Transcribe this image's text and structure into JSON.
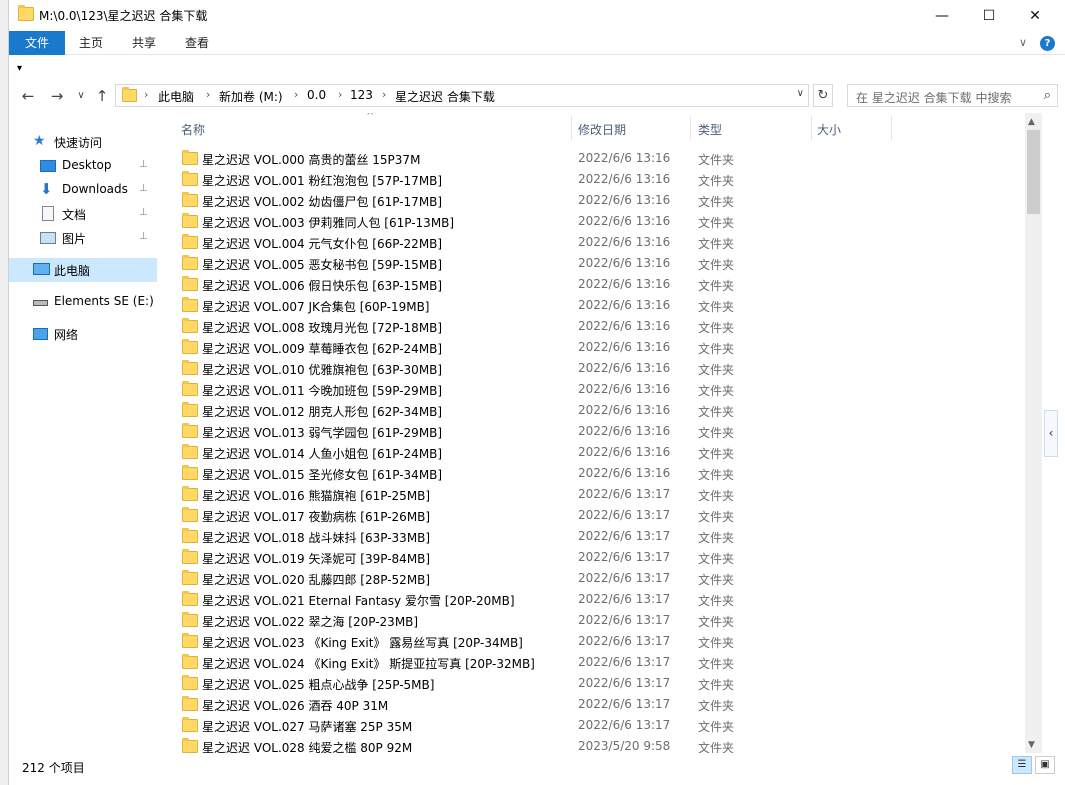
{
  "window": {
    "title": "M:\\0.0\\123\\星之迟迟 合集下载",
    "minimize_glyph": "—",
    "maximize_glyph": "☐",
    "close_glyph": "✕"
  },
  "ribbon": {
    "tabs": [
      "文件",
      "主页",
      "共享",
      "查看"
    ],
    "expand_glyph": "∨",
    "help_glyph": "?"
  },
  "qat": {
    "arrow": "▾"
  },
  "nav": {
    "back": "←",
    "forward": "→",
    "recent": "∨",
    "up": "↑",
    "breadcrumb": [
      "此电脑",
      "新加卷 (M:)",
      "0.0",
      "123",
      "星之迟迟 合集下载"
    ],
    "separator": "›",
    "address_dropdown": "∨",
    "refresh": "↻",
    "search_placeholder": "在 星之迟迟 合集下载 中搜索",
    "search_icon": "⌕"
  },
  "navpane": {
    "items": [
      {
        "label": "快速访问",
        "icon": "star-icon",
        "pinned": false
      },
      {
        "label": "Desktop",
        "icon": "desktop-icon",
        "pinned": true
      },
      {
        "label": "Downloads",
        "icon": "download-icon",
        "pinned": true
      },
      {
        "label": "文档",
        "icon": "document-icon",
        "pinned": true
      },
      {
        "label": "图片",
        "icon": "pictures-icon",
        "pinned": true
      },
      {
        "label": "此电脑",
        "icon": "computer-icon",
        "pinned": false,
        "selected": true
      },
      {
        "label": "Elements SE (E:)",
        "icon": "drive-icon",
        "pinned": false
      },
      {
        "label": "网络",
        "icon": "network-icon",
        "pinned": false
      }
    ],
    "pin_glyph": "📌"
  },
  "columns": {
    "name": "名称",
    "date": "修改日期",
    "type": "类型",
    "size": "大小",
    "sort_glyph": "^"
  },
  "files": [
    {
      "name": "星之迟迟 VOL.000 高贵的蕾丝 15P37M",
      "date": "2022/6/6 13:16",
      "type": "文件夹"
    },
    {
      "name": "星之迟迟 VOL.001 粉红泡泡包 [57P-17MB]",
      "date": "2022/6/6 13:16",
      "type": "文件夹"
    },
    {
      "name": "星之迟迟 VOL.002 幼齿僵尸包 [61P-17MB]",
      "date": "2022/6/6 13:16",
      "type": "文件夹"
    },
    {
      "name": "星之迟迟 VOL.003 伊莉雅同人包 [61P-13MB]",
      "date": "2022/6/6 13:16",
      "type": "文件夹"
    },
    {
      "name": "星之迟迟 VOL.004 元气女仆包 [66P-22MB]",
      "date": "2022/6/6 13:16",
      "type": "文件夹"
    },
    {
      "name": "星之迟迟 VOL.005 恶女秘书包 [59P-15MB]",
      "date": "2022/6/6 13:16",
      "type": "文件夹"
    },
    {
      "name": "星之迟迟 VOL.006 假日快乐包 [63P-15MB]",
      "date": "2022/6/6 13:16",
      "type": "文件夹"
    },
    {
      "name": "星之迟迟 VOL.007 JK合集包 [60P-19MB]",
      "date": "2022/6/6 13:16",
      "type": "文件夹"
    },
    {
      "name": "星之迟迟 VOL.008 玫瑰月光包 [72P-18MB]",
      "date": "2022/6/6 13:16",
      "type": "文件夹"
    },
    {
      "name": "星之迟迟 VOL.009 草莓睡衣包 [62P-24MB]",
      "date": "2022/6/6 13:16",
      "type": "文件夹"
    },
    {
      "name": "星之迟迟 VOL.010 优雅旗袍包 [63P-30MB]",
      "date": "2022/6/6 13:16",
      "type": "文件夹"
    },
    {
      "name": "星之迟迟 VOL.011 今晚加班包 [59P-29MB]",
      "date": "2022/6/6 13:16",
      "type": "文件夹"
    },
    {
      "name": "星之迟迟 VOL.012 朋克人形包 [62P-34MB]",
      "date": "2022/6/6 13:16",
      "type": "文件夹"
    },
    {
      "name": "星之迟迟 VOL.013 弱气学园包 [61P-29MB]",
      "date": "2022/6/6 13:16",
      "type": "文件夹"
    },
    {
      "name": "星之迟迟 VOL.014 人鱼小姐包 [61P-24MB]",
      "date": "2022/6/6 13:16",
      "type": "文件夹"
    },
    {
      "name": "星之迟迟 VOL.015 圣光修女包 [61P-34MB]",
      "date": "2022/6/6 13:16",
      "type": "文件夹"
    },
    {
      "name": "星之迟迟 VOL.016 熊猫旗袍 [61P-25MB]",
      "date": "2022/6/6 13:17",
      "type": "文件夹"
    },
    {
      "name": "星之迟迟 VOL.017 夜勤病栋 [61P-26MB]",
      "date": "2022/6/6 13:17",
      "type": "文件夹"
    },
    {
      "name": "星之迟迟 VOL.018 战斗妹抖 [63P-33MB]",
      "date": "2022/6/6 13:17",
      "type": "文件夹"
    },
    {
      "name": "星之迟迟 VOL.019 矢泽妮可 [39P-84MB]",
      "date": "2022/6/6 13:17",
      "type": "文件夹"
    },
    {
      "name": "星之迟迟 VOL.020 乱藤四郎 [28P-52MB]",
      "date": "2022/6/6 13:17",
      "type": "文件夹"
    },
    {
      "name": "星之迟迟 VOL.021 Eternal Fantasy 爱尔雪 [20P-20MB]",
      "date": "2022/6/6 13:17",
      "type": "文件夹"
    },
    {
      "name": "星之迟迟 VOL.022 翠之海 [20P-23MB]",
      "date": "2022/6/6 13:17",
      "type": "文件夹"
    },
    {
      "name": "星之迟迟 VOL.023 《King Exit》 露易丝写真 [20P-34MB]",
      "date": "2022/6/6 13:17",
      "type": "文件夹"
    },
    {
      "name": "星之迟迟 VOL.024 《King Exit》 斯提亚拉写真 [20P-32MB]",
      "date": "2022/6/6 13:17",
      "type": "文件夹"
    },
    {
      "name": "星之迟迟 VOL.025 粗点心战争 [25P-5MB]",
      "date": "2022/6/6 13:17",
      "type": "文件夹"
    },
    {
      "name": "星之迟迟 VOL.026 酒吞 40P 31M",
      "date": "2022/6/6 13:17",
      "type": "文件夹"
    },
    {
      "name": "星之迟迟 VOL.027 马萨诸塞 25P 35M",
      "date": "2022/6/6 13:17",
      "type": "文件夹"
    },
    {
      "name": "星之迟迟 VOL.028 纯爱之槛 80P 92M",
      "date": "2023/5/20 9:58",
      "type": "文件夹"
    }
  ],
  "scrollbar": {
    "up": "▲",
    "down": "▼"
  },
  "side_tab": "‹",
  "status": {
    "item_count": "212 个项目"
  },
  "view_buttons": {
    "details": "☰",
    "large_icons": "▣"
  },
  "colors": {
    "accent": "#1979ca",
    "selection": "#cce8ff",
    "folder": "#ffd866"
  }
}
